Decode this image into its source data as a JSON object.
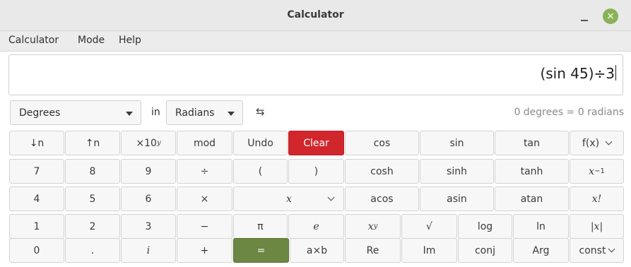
{
  "window": {
    "title": "Calculator",
    "close_glyph": "×"
  },
  "menu": [
    "Calculator",
    "Mode",
    "Help"
  ],
  "display": {
    "expression": "(sin 45)÷3"
  },
  "conversion": {
    "from_unit": "Degrees",
    "in_label": "in",
    "to_unit": "Radians",
    "swap_glyph": "⇆",
    "result": "0 degrees = 0 radians"
  },
  "keypad": {
    "row1": {
      "shift_down": "↓n",
      "shift_up": "↑n",
      "sci_base": "×10",
      "sci_exp": "y",
      "mod": "mod",
      "undo": "Undo",
      "clear": "Clear",
      "cos": "cos",
      "sin": "sin",
      "tan": "tan",
      "fx": "f(x)"
    },
    "row2": {
      "seven": "7",
      "eight": "8",
      "nine": "9",
      "divide": "÷",
      "open_paren": "(",
      "close_paren": ")",
      "cosh": "cosh",
      "sinh": "sinh",
      "tanh": "tanh",
      "inverse_base": "x",
      "inverse_exp": "−1"
    },
    "row3": {
      "four": "4",
      "five": "5",
      "six": "6",
      "multiply": "×",
      "variable": "x",
      "acos": "acos",
      "asin": "asin",
      "atan": "atan",
      "factorial": "x!"
    },
    "row4": {
      "one": "1",
      "two": "2",
      "three": "3",
      "minus": "−",
      "pi": "π",
      "e": "e",
      "power_base": "x",
      "power_exp": "y",
      "sqrt": "√",
      "log": "log",
      "ln": "ln",
      "abs": "|x|"
    },
    "row5": {
      "zero": "0",
      "point": ".",
      "imaginary": "i",
      "plus": "+",
      "equals": "=",
      "axb": "a×b",
      "re": "Re",
      "im": "Im",
      "conj": "conj",
      "arg": "Arg",
      "const": "const"
    }
  },
  "colors": {
    "clear_button": "#d0262c",
    "equals_button": "#6b8741",
    "close_button": "#8bb158"
  }
}
